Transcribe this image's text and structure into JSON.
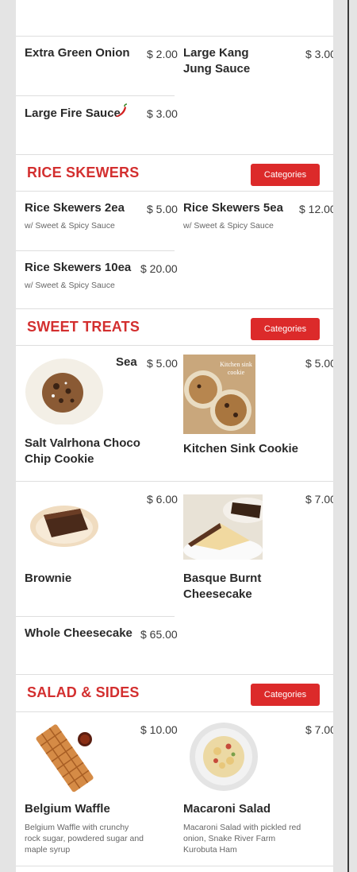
{
  "sauces": [
    {
      "name": "Extra Green Onion",
      "price": "$ 2.00"
    },
    {
      "name": "Large Kang Jung Sauce",
      "price": "$ 3.00"
    },
    {
      "name": "Large Fire Sauce",
      "price": "$ 3.00",
      "icon": "chili-pepper-icon"
    }
  ],
  "rice_skewers": {
    "title": "RICE SKEWERS",
    "button": "Categories",
    "items": [
      {
        "name": "Rice Skewers 2ea",
        "price": "$ 5.00",
        "desc": "w/ Sweet & Spicy Sauce"
      },
      {
        "name": "Rice Skewers 5ea",
        "price": "$ 12.00",
        "desc": "w/ Sweet & Spicy Sauce"
      },
      {
        "name": "Rice Skewers 10ea",
        "price": "$ 20.00",
        "desc": "w/ Sweet & Spicy Sauce"
      }
    ]
  },
  "sweet_treats": {
    "title": "SWEET TREATS",
    "button": "Categories",
    "items": [
      {
        "name": "Salt Valrhona Choco Chip Cookie",
        "price": "$ 5.00",
        "overlay": "Sea"
      },
      {
        "name": "Kitchen Sink Cookie",
        "price": "$ 5.00",
        "img_text": "Kitchen sink cookie"
      },
      {
        "name": "Brownie",
        "price": "$ 6.00"
      },
      {
        "name": "Basque Burnt Cheesecake",
        "price": "$ 7.00"
      },
      {
        "name": "Whole Cheesecake",
        "price": "$ 65.00"
      }
    ]
  },
  "salad_sides": {
    "title": "SALAD & SIDES",
    "button": "Categories",
    "items": [
      {
        "name": "Belgium Waffle",
        "price": "$ 10.00",
        "desc": "Belgium Waffle with crunchy rock sugar, powdered sugar and maple syrup"
      },
      {
        "name": "Macaroni Salad",
        "price": "$ 7.00",
        "desc": "Macaroni Salad with pickled red onion, Snake River Farm Kurobuta Ham"
      }
    ]
  },
  "colors": {
    "accent": "#dc2a2a",
    "section_title": "#d32f2f"
  }
}
